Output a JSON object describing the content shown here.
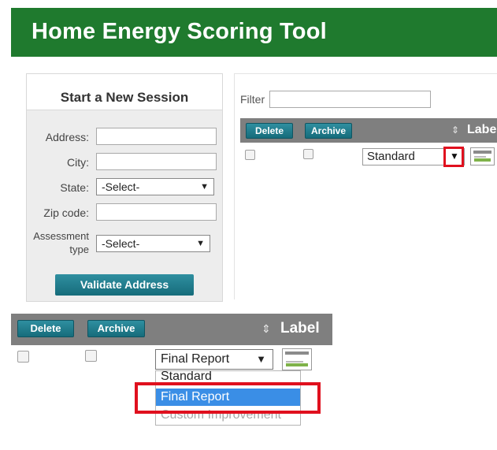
{
  "header": {
    "title": "Home Energy Scoring Tool"
  },
  "session": {
    "title": "Start a New Session",
    "fields": {
      "address_label": "Address:",
      "city_label": "City:",
      "state_label": "State:",
      "state_value": "-Select-",
      "zip_label": "Zip code:",
      "assessment_label_line1": "Assessment",
      "assessment_label_line2": "type",
      "assessment_value": "-Select-"
    },
    "validate_label": "Validate Address"
  },
  "list_panel": {
    "filter_label": "Filter",
    "toolbar": {
      "delete_label": "Delete",
      "archive_label": "Archive",
      "label_header": "Labe",
      "sort_icon": "⇕"
    },
    "row": {
      "label_value": "Standard"
    }
  },
  "callout": {
    "toolbar": {
      "delete_label": "Delete",
      "archive_label": "Archive",
      "label_header": "Label"
    },
    "row": {
      "label_value": "Final Report"
    },
    "dropdown_options": [
      "Standard",
      "Final Report",
      "Custom Improvement"
    ],
    "selected_option": "Final Report"
  },
  "colors": {
    "header_bg": "#1f7a2e",
    "button_teal": "#166c7b",
    "highlight_red": "#e0101e",
    "selection_blue": "#3a8ee6"
  }
}
